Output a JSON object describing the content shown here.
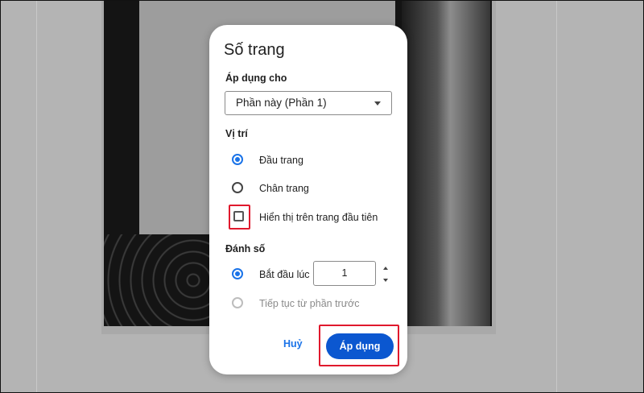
{
  "dialog": {
    "title": "Số trang",
    "apply_to": {
      "label": "Áp dụng cho",
      "selected": "Phần này (Phần 1)"
    },
    "position": {
      "label": "Vị trí",
      "options": [
        {
          "label": "Đầu trang",
          "checked": true
        },
        {
          "label": "Chân trang",
          "checked": false
        }
      ],
      "show_first_page": {
        "label": "Hiển thị trên trang đầu tiên",
        "checked": false
      }
    },
    "numbering": {
      "label": "Đánh số",
      "start_at": {
        "label": "Bắt đầu lúc",
        "value": "1",
        "checked": true
      },
      "continue": {
        "label": "Tiếp tục từ phần trước",
        "checked": false,
        "disabled": true
      }
    },
    "buttons": {
      "cancel": "Huỷ",
      "apply": "Áp dụng"
    }
  },
  "colors": {
    "accent": "#1a73e8",
    "apply_button": "#0b57d0",
    "highlight": "#e0192d",
    "background": "#b4b4b4"
  },
  "icons": [
    "dropdown-caret-icon",
    "spin-up-icon",
    "spin-down-icon"
  ]
}
